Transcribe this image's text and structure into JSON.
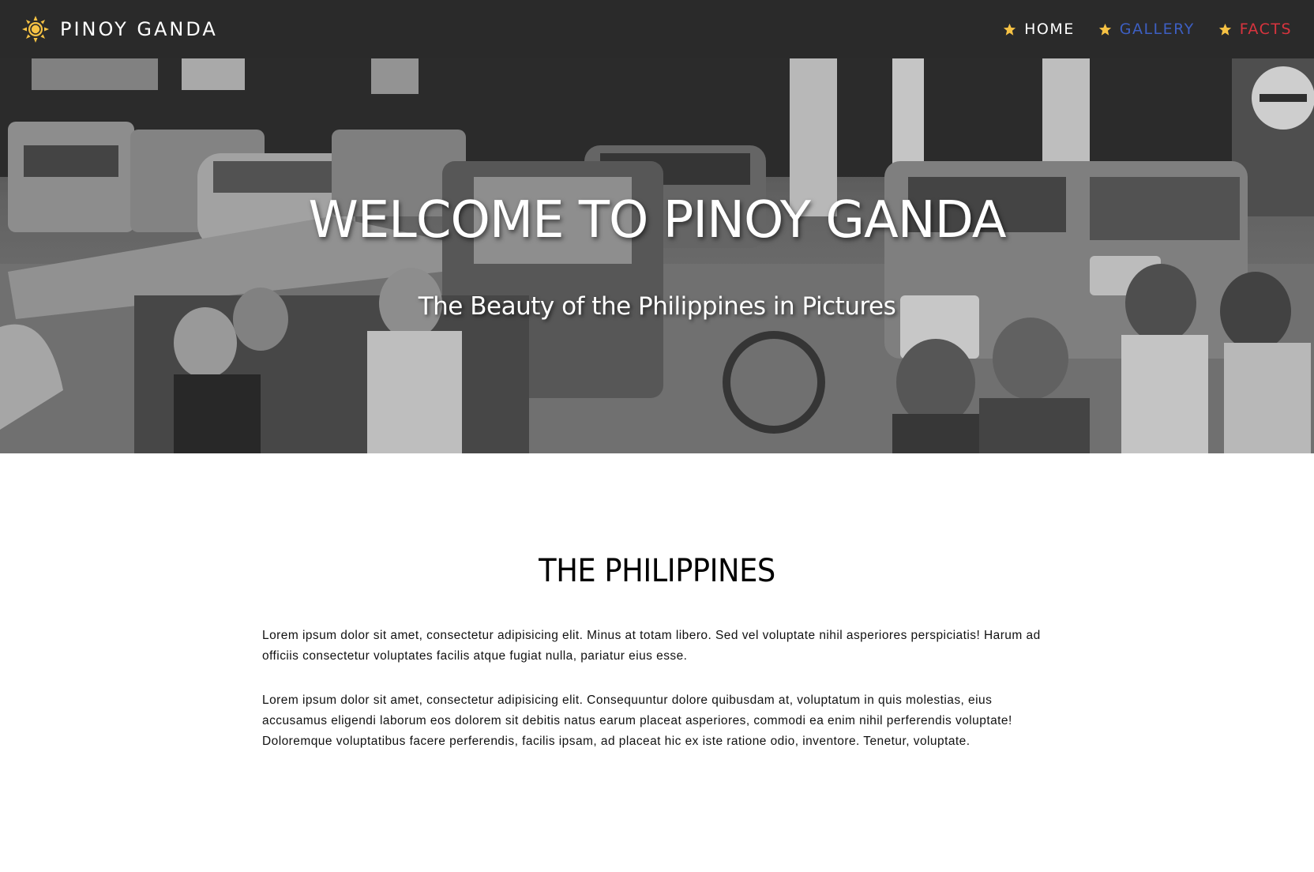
{
  "brand": {
    "name": "PINOY GANDA",
    "icon": "sun-icon",
    "icon_color": "#f6c244"
  },
  "nav": {
    "items": [
      {
        "label": "HOME",
        "icon": "star-icon",
        "color": "#ffffff"
      },
      {
        "label": "GALLERY",
        "icon": "star-icon",
        "color": "#3d5fc2"
      },
      {
        "label": "FACTS",
        "icon": "star-icon",
        "color": "#d8343e"
      }
    ],
    "star_color": "#f6c244"
  },
  "hero": {
    "title": "WELCOME TO PINOY GANDA",
    "subtitle": "The Beauty of the Philippines in Pictures",
    "image": "black-and-white street scene with jeepneys and tricycles"
  },
  "section": {
    "title": "THE PHILIPPINES",
    "paragraphs": [
      "Lorem ipsum dolor sit amet, consectetur adipisicing elit. Minus at totam libero. Sed vel voluptate nihil asperiores perspiciatis! Harum ad officiis consectetur voluptates facilis atque fugiat nulla, pariatur eius esse.",
      "Lorem ipsum dolor sit amet, consectetur adipisicing elit. Consequuntur dolore quibusdam at, voluptatum in quis molestias, eius accusamus eligendi laborum eos dolorem sit debitis natus earum placeat asperiores, commodi ea enim nihil perferendis voluptate! Doloremque voluptatibus facere perferendis, facilis ipsam, ad placeat hic ex iste ratione odio, inventore. Tenetur, voluptate."
    ]
  }
}
